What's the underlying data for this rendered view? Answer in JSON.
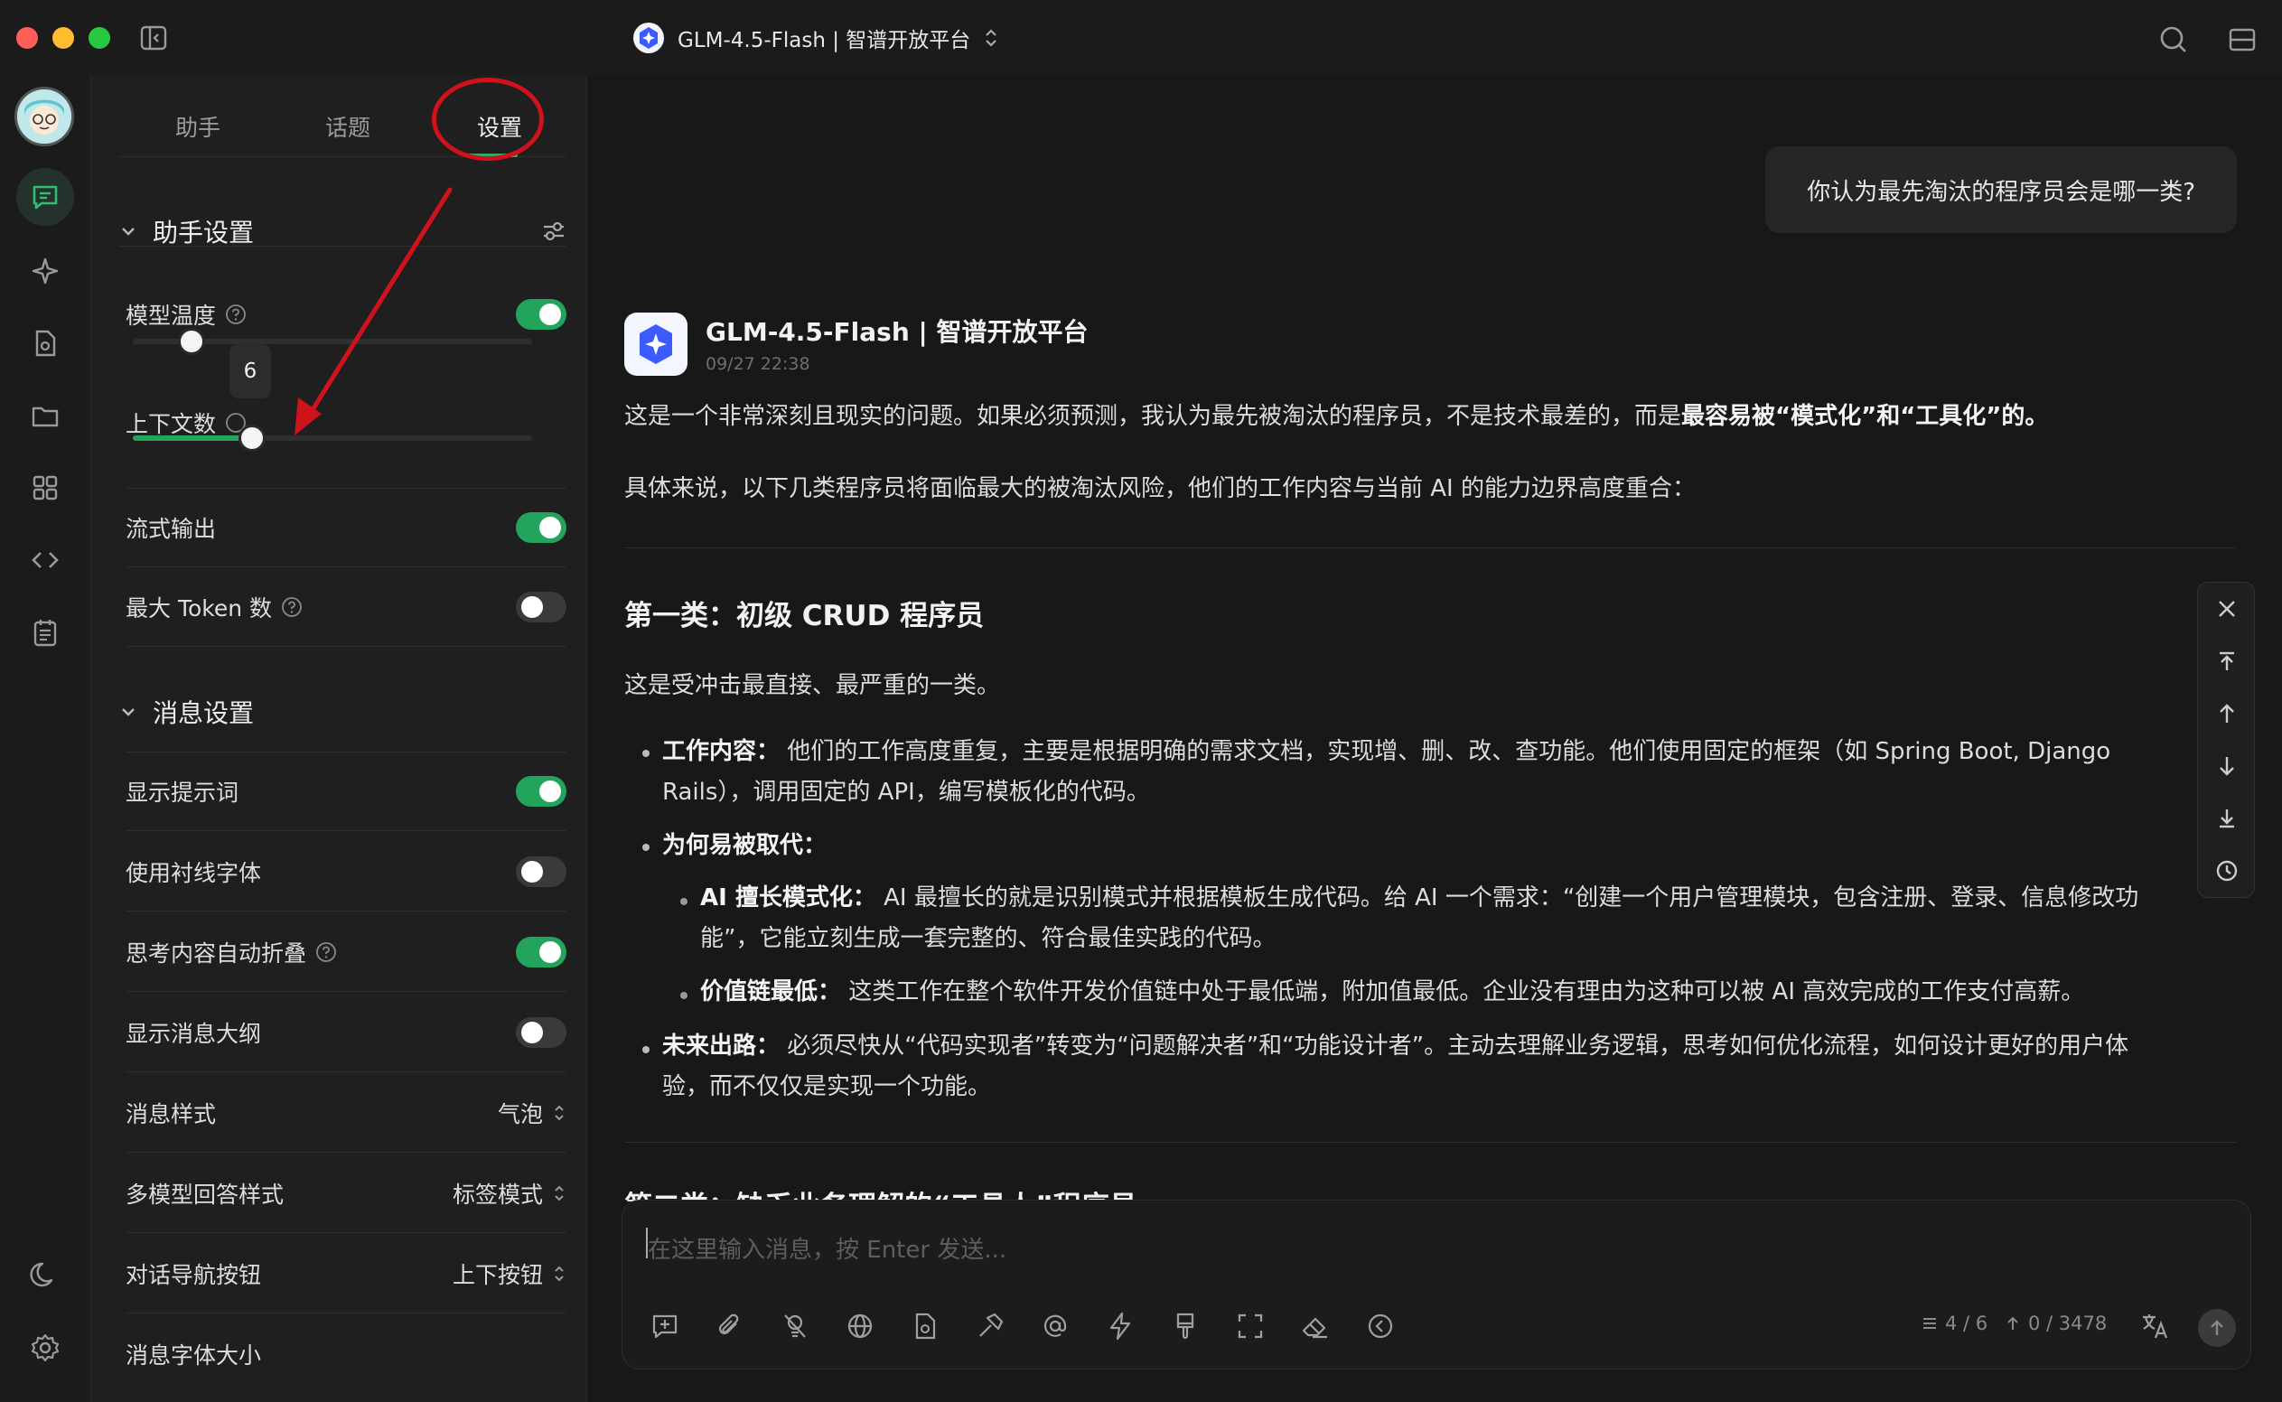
{
  "window": {
    "title": "GLM-4.5-Flash | 智谱开放平台"
  },
  "panel": {
    "tabs": [
      "助手",
      "话题",
      "设置"
    ],
    "assistant_section": {
      "title": "助手设置",
      "temperature_label": "模型温度",
      "temperature_enabled": true,
      "context_label": "上下文数",
      "context_value": "6",
      "stream_label": "流式输出",
      "stream_enabled": true,
      "max_token_label": "最大 Token 数",
      "max_token_enabled": false
    },
    "message_section": {
      "title": "消息设置",
      "show_prompt_label": "显示提示词",
      "show_prompt_enabled": true,
      "serif_label": "使用衬线字体",
      "serif_enabled": false,
      "fold_label": "思考内容自动折叠",
      "fold_enabled": true,
      "outline_label": "显示消息大纲",
      "outline_enabled": false,
      "style_label": "消息样式",
      "style_value": "气泡",
      "multi_label": "多模型回答样式",
      "multi_value": "标签模式",
      "nav_label": "对话导航按钮",
      "nav_value": "上下按钮",
      "font_label": "消息字体大小"
    }
  },
  "chat": {
    "user_message": "你认为最先淘汰的程序员会是哪一类?",
    "model_name": "GLM-4.5-Flash | 智谱开放平台",
    "model_time": "09/27 22:38",
    "p1_a": "这是一个非常深刻且现实的问题。如果必须预测，我认为最先被淘汰的程序员，不是技术最差的，而是",
    "p1_b": "最容易被“模式化”和“工具化”的。",
    "p2": "具体来说，以下几类程序员将面临最大的被淘汰风险，他们的工作内容与当前 AI 的能力边界高度重合：",
    "h1": "第一类：初级 CRUD 程序员",
    "p3": "这是受冲击最直接、最严重的一类。",
    "li1_b": "工作内容：",
    "li1_t1": " 他们的工作高度重复，主要是根据明确的需求文档，实现增、删、改、查功能。他们使用固定的框架（如 Spring Boot, Django",
    "li1_t2": "Rails），调用固定的 API，编写模板化的代码。",
    "li2_b": "为何易被取代：",
    "li2a_b": "AI 擅长模式化：",
    "li2a_t1": " AI 最擅长的就是识别模式并根据模板生成代码。给 AI 一个需求：“创建一个用户管理模块，包含注册、登录、信息修改功",
    "li2a_t2": "能”，它能立刻生成一套完整的、符合最佳实践的代码。",
    "li2b_b": "价值链最低：",
    "li2b_t": " 这类工作在整个软件开发价值链中处于最低端，附加值最低。企业没有理由为这种可以被 AI 高效完成的工作支付高薪。",
    "li3_b": "未来出路：",
    "li3_t1": " 必须尽快从“代码实现者”转变为“问题解决者”和“功能设计者”。主动去理解业务逻辑，思考如何优化流程，如何设计更好的用户体",
    "li3_t2": "验，而不仅仅是实现一个功能。",
    "h2_partial": "第二类：缺乏业务理解的“工具人”程序员"
  },
  "input": {
    "placeholder": "在这里输入消息，按 Enter 发送...",
    "context_count": "4 / 6",
    "token_count": "0 / 3478"
  },
  "colors": {
    "accent": "#22a45d",
    "annotation": "#d0121c"
  }
}
